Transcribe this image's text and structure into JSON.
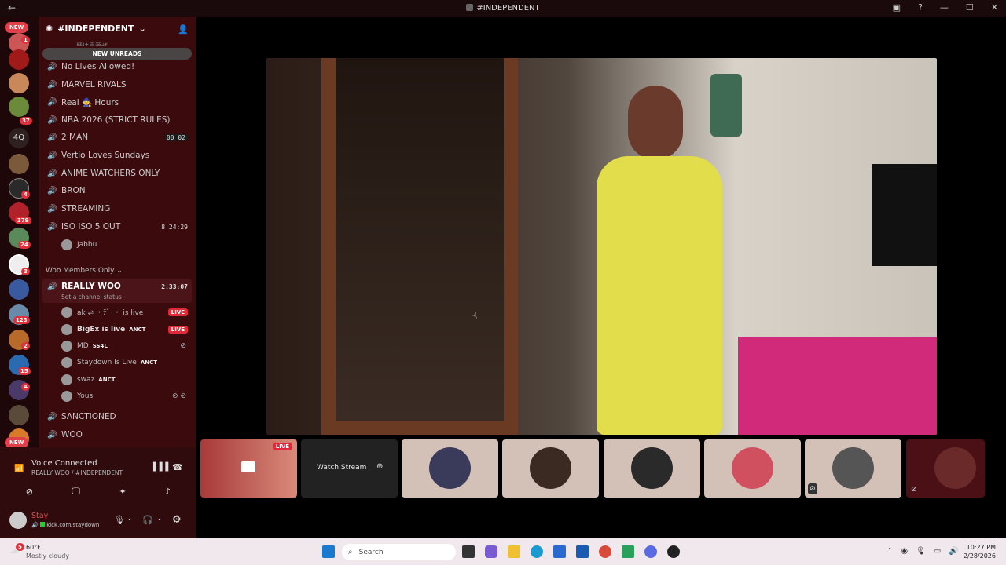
{
  "window": {
    "title": "#INDEPENDENT",
    "back_icon": "back-arrow-icon"
  },
  "servers": {
    "new_top": "NEW",
    "new_bottom": "NEW",
    "text_server": "4Q",
    "badges": [
      "1",
      "37",
      "4",
      "379",
      "24",
      "3",
      "123",
      "2",
      "15",
      "4"
    ]
  },
  "channel_list": {
    "guild_name": "#INDEPENDENT",
    "new_unreads": "NEW UNREADS",
    "cut_off_channel": "懸は眉源ぜ",
    "channels": [
      {
        "name": "No Lives Allowed!"
      },
      {
        "name": "MARVEL RIVALS"
      },
      {
        "name": "Real 🧙 Hours"
      },
      {
        "name": "NBA 2026 (STRICT RULES)"
      },
      {
        "name": "2 MAN",
        "counts": [
          "00",
          "02"
        ]
      },
      {
        "name": "Vertio Loves Sundays"
      },
      {
        "name": "ANIME WATCHERS ONLY"
      },
      {
        "name": "BRON"
      },
      {
        "name": "STREAMING"
      },
      {
        "name": "ISO ISO 5 OUT",
        "timer": "8:24:29"
      }
    ],
    "iso_user": "Jabbu",
    "category": "Woo Members Only",
    "active_channel": {
      "name": "REALLY WOO",
      "timer": "2:33:07",
      "status": "Set a channel status"
    },
    "members": [
      {
        "name": "ak ⇌ ・ﾃﾞｰ・ is live",
        "live": "LIVE"
      },
      {
        "name": "BigEx is live",
        "tag": "ANCT",
        "live": "LIVE"
      },
      {
        "name": "MD",
        "tag": "SS4L"
      },
      {
        "name": "Staydown Is Live",
        "tag": "ANCT"
      },
      {
        "name": "swaz",
        "tag": "ANCT"
      },
      {
        "name": "Yous"
      }
    ],
    "after_channels": [
      {
        "name": "SANCTIONED"
      },
      {
        "name": "WOO"
      }
    ]
  },
  "voice": {
    "status": "Voice Connected",
    "location": "REALLY WOO / #INDEPENDENT",
    "user_name": "Stay",
    "user_status": "kick.com/staydown"
  },
  "stage": {
    "thumb_live": "LIVE",
    "watch_stream": "Watch Stream"
  },
  "taskbar": {
    "weather_temp": "60°F",
    "weather_desc": "Mostly cloudy",
    "weather_badge": "5",
    "search_placeholder": "Search",
    "time": "10:27 PM",
    "date": "2/28/2026"
  }
}
